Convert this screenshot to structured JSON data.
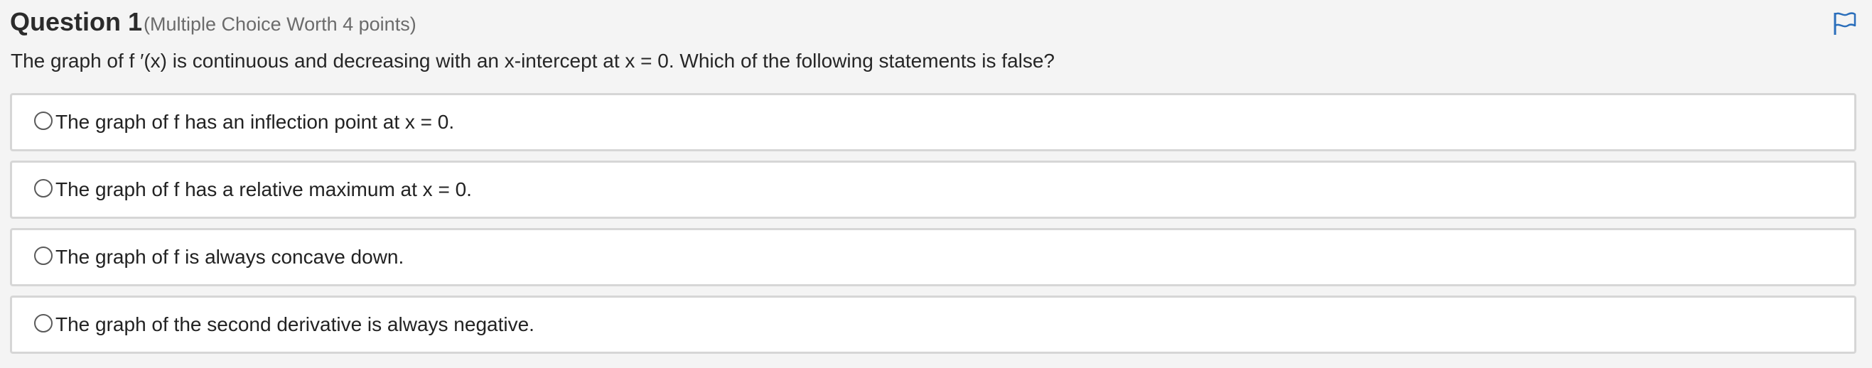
{
  "question": {
    "title": "Question 1",
    "meta": "(Multiple Choice Worth 4 points)",
    "text": "The graph of f ′(x) is continuous and decreasing with an x-intercept at x = 0. Which of the following statements is false?",
    "flag_icon": "flag-icon",
    "accent_color": "#2a6ebb"
  },
  "choices": [
    {
      "label": "The graph of f has an inflection point at x = 0.",
      "selected": false
    },
    {
      "label": "The graph of f has a relative maximum at x = 0.",
      "selected": false
    },
    {
      "label": "The graph of f is always concave down.",
      "selected": false
    },
    {
      "label": "The graph of the second derivative is always negative.",
      "selected": false
    }
  ]
}
